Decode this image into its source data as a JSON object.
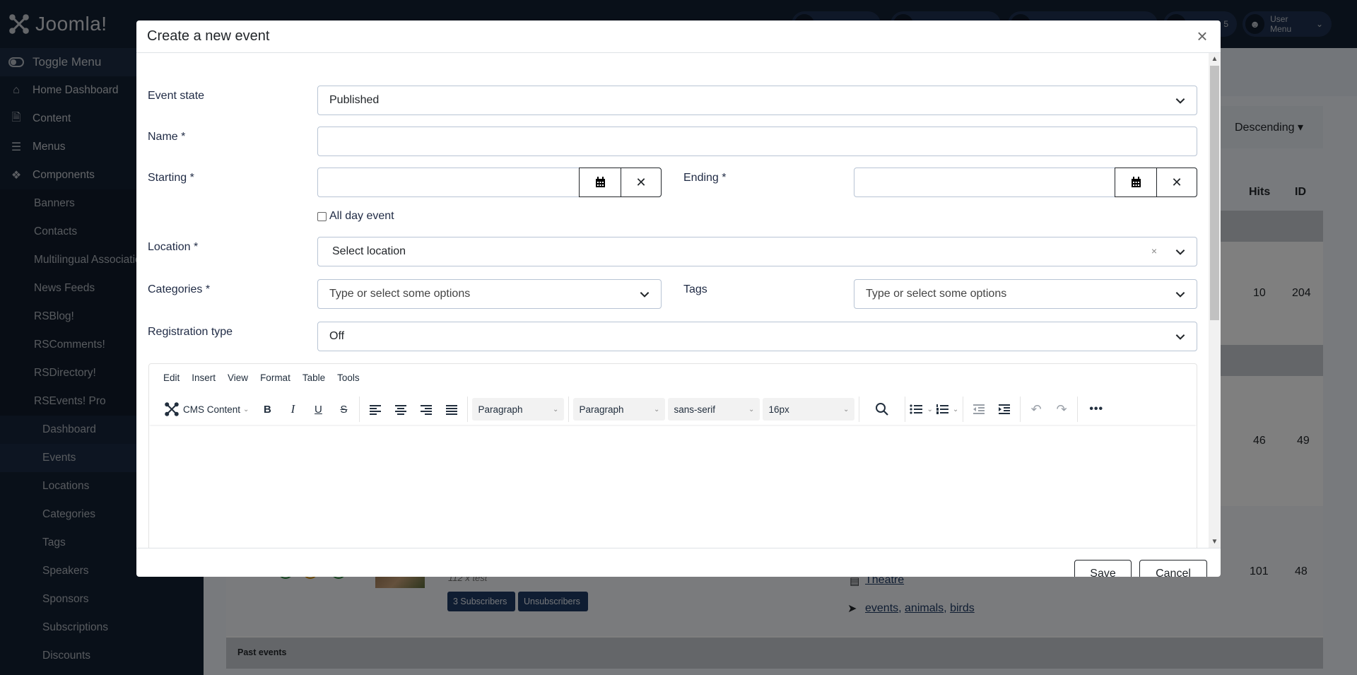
{
  "app": {
    "brand": "Joomla!",
    "toggle_menu": "Toggle Menu"
  },
  "sidebar": {
    "main_items": [
      {
        "label": "Home Dashboard",
        "icon": "home-icon"
      },
      {
        "label": "Content",
        "icon": "file-icon"
      },
      {
        "label": "Menus",
        "icon": "list-icon"
      },
      {
        "label": "Components",
        "icon": "puzzle-icon"
      }
    ],
    "component_items": [
      "Banners",
      "Contacts",
      "Multilingual Associations",
      "News Feeds",
      "RSBlog!",
      "RSComments!",
      "RSDirectory!",
      "RSEvents! Pro"
    ],
    "rsevents_items": [
      "Dashboard",
      "Events",
      "Locations",
      "Categories",
      "Tags",
      "Speakers",
      "Sponsors",
      "Subscriptions",
      "Discounts"
    ],
    "active_item": "Events"
  },
  "topbar": {
    "user_menu": "User Menu",
    "badge_count": "5"
  },
  "background": {
    "sort_direction": "Descending",
    "columns": {
      "hits": "Hits",
      "id": "ID"
    },
    "rows": [
      {
        "hits": "10",
        "id": "204"
      },
      {
        "hits": "46",
        "id": "49"
      },
      {
        "hits": "101",
        "id": "48",
        "meta": "112 x test",
        "category": "Theatre",
        "tags": [
          "events",
          "animals",
          "birds"
        ],
        "subscribers_label": "3 Subscribers",
        "unsubscribers_label": "Unsubscribers"
      }
    ],
    "past_events_label": "Past events",
    "tag_separator": ", "
  },
  "modal": {
    "title": "Create a new event",
    "close_label": "×",
    "fields": {
      "event_state": {
        "label": "Event state",
        "value": "Published"
      },
      "name": {
        "label": "Name *",
        "value": ""
      },
      "starting": {
        "label": "Starting *",
        "value": ""
      },
      "ending": {
        "label": "Ending *",
        "value": ""
      },
      "all_day": {
        "label": "All day event",
        "checked": false
      },
      "location": {
        "label": "Location *",
        "placeholder": "Select location"
      },
      "categories": {
        "label": "Categories *",
        "placeholder": "Type or select some options"
      },
      "tags": {
        "label": "Tags",
        "placeholder": "Type or select some options"
      },
      "registration_type": {
        "label": "Registration type",
        "value": "Off"
      }
    },
    "editor": {
      "menu": [
        "Edit",
        "Insert",
        "View",
        "Format",
        "Table",
        "Tools"
      ],
      "cms_content": "CMS Content",
      "block_format": "Paragraph",
      "style_format": "Paragraph",
      "font_family": "sans-serif",
      "font_size": "16px",
      "content": ""
    },
    "footer": {
      "save": "Save",
      "cancel": "Cancel"
    }
  }
}
